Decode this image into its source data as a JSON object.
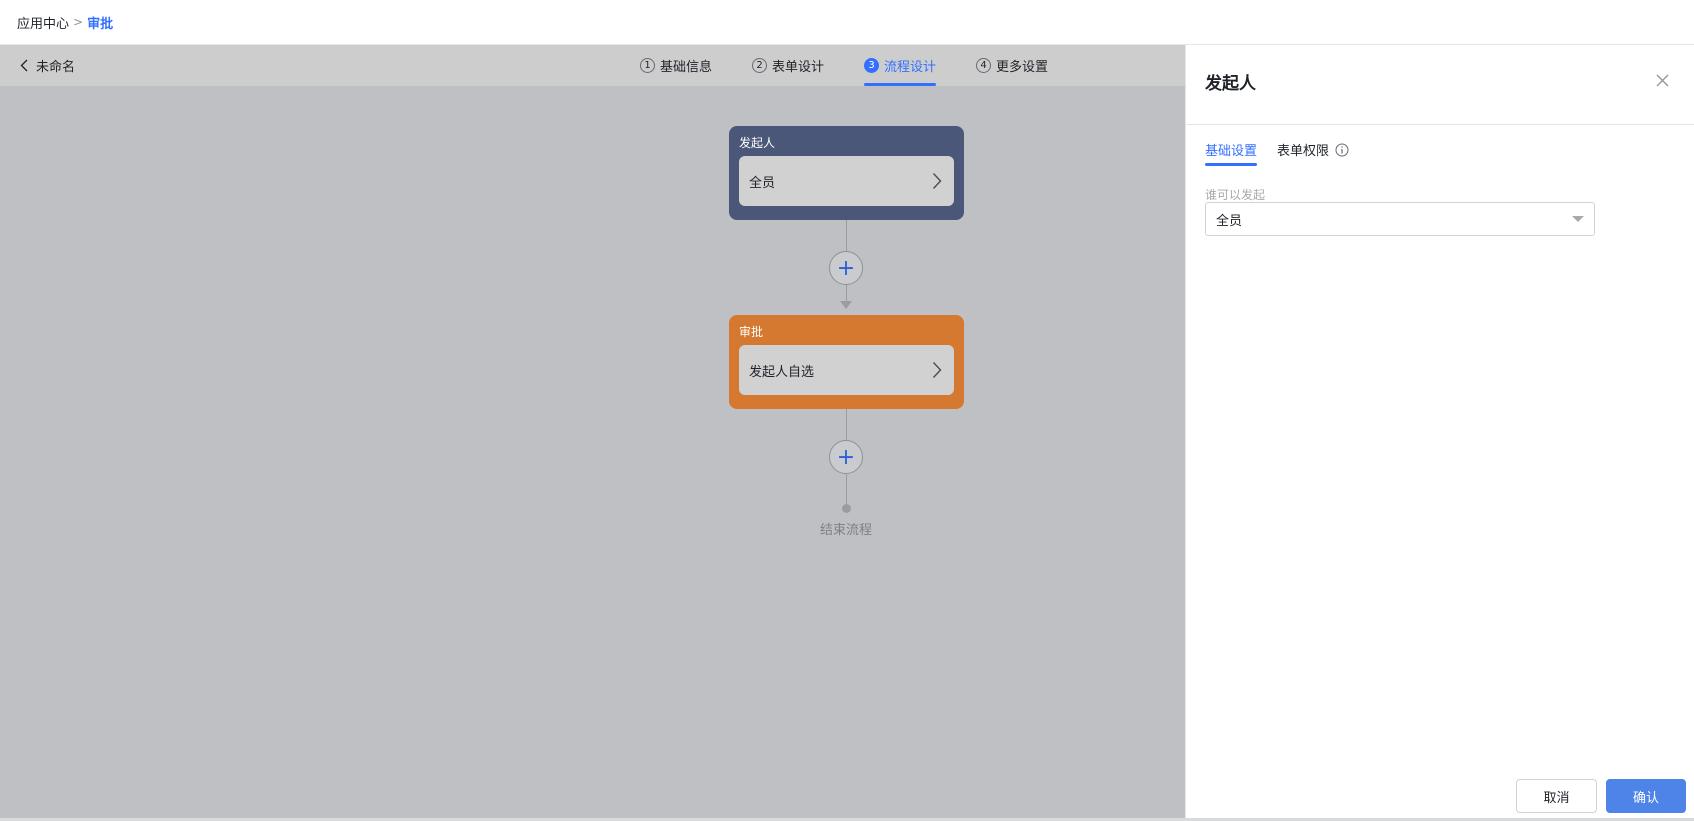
{
  "breadcrumb": {
    "root": "应用中心",
    "separator": ">",
    "current": "审批"
  },
  "subnav": {
    "back_label": "未命名",
    "back_icon": "chevron-left-icon"
  },
  "steps": [
    {
      "num": "1",
      "label": "基础信息",
      "active": false
    },
    {
      "num": "2",
      "label": "表单设计",
      "active": false
    },
    {
      "num": "3",
      "label": "流程设计",
      "active": true
    },
    {
      "num": "4",
      "label": "更多设置",
      "active": false
    }
  ],
  "flow": {
    "starter": {
      "title": "发起人",
      "value": "全员",
      "color": "#4b5778"
    },
    "approve": {
      "title": "审批",
      "value": "发起人自选",
      "color": "#d4792f"
    },
    "add_symbol": "+",
    "end_label": "结束流程"
  },
  "panel": {
    "title": "发起人",
    "tabs": [
      {
        "label": "基础设置",
        "active": true
      },
      {
        "label": "表单权限",
        "active": false,
        "icon": "info-icon"
      }
    ],
    "field_label": "谁可以发起",
    "field_value": "全员",
    "cancel_label": "取消",
    "confirm_label": "确认",
    "accent_color": "#3370ff"
  }
}
